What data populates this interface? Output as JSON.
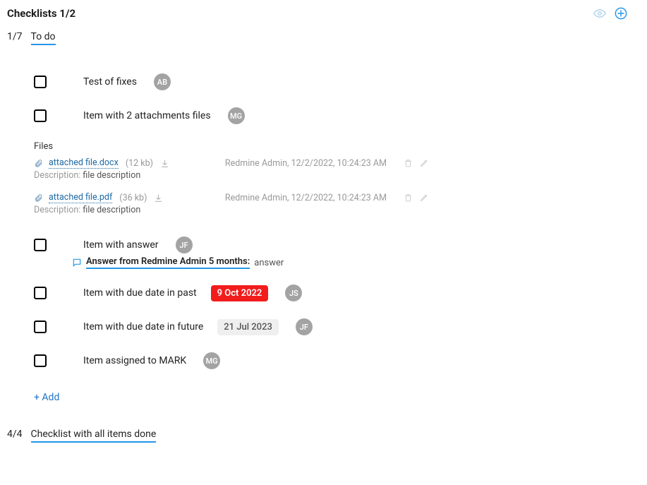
{
  "header": {
    "title": "Checklists 1/2"
  },
  "checklists": [
    {
      "fraction": "1/7",
      "name": "To do",
      "items": [
        {
          "label": "Test of fixes",
          "avatar": "AB"
        },
        {
          "label": "Item with 2 attachments files",
          "avatar": "MG"
        },
        {
          "label": "Item with answer",
          "avatar": "JF"
        },
        {
          "label": "Item with due date in past",
          "due": "9 Oct 2022",
          "due_class": "past",
          "avatar": "JS"
        },
        {
          "label": "Item with due date in future",
          "due": "21 Jul 2023",
          "due_class": "future",
          "avatar": "JF"
        },
        {
          "label": "Item assigned to MARK",
          "avatar": "MG"
        }
      ],
      "files_header": "Files",
      "files": [
        {
          "name": "attached file.docx",
          "size": "(12 kb)",
          "meta": "Redmine Admin, 12/2/2022, 10:24:23 AM",
          "desc_label": "Description:",
          "desc_text": "file description"
        },
        {
          "name": "attached file.pdf",
          "size": "(36 kb)",
          "meta": "Redmine Admin, 12/2/2022, 10:24:23 AM",
          "desc_label": "Description:",
          "desc_text": "file description"
        }
      ],
      "answer": {
        "prefix": "Answer from Redmine Admin 5 months:",
        "text": "answer"
      },
      "add_label": "+ Add"
    },
    {
      "fraction": "4/4",
      "name": "Checklist with all items done"
    }
  ]
}
